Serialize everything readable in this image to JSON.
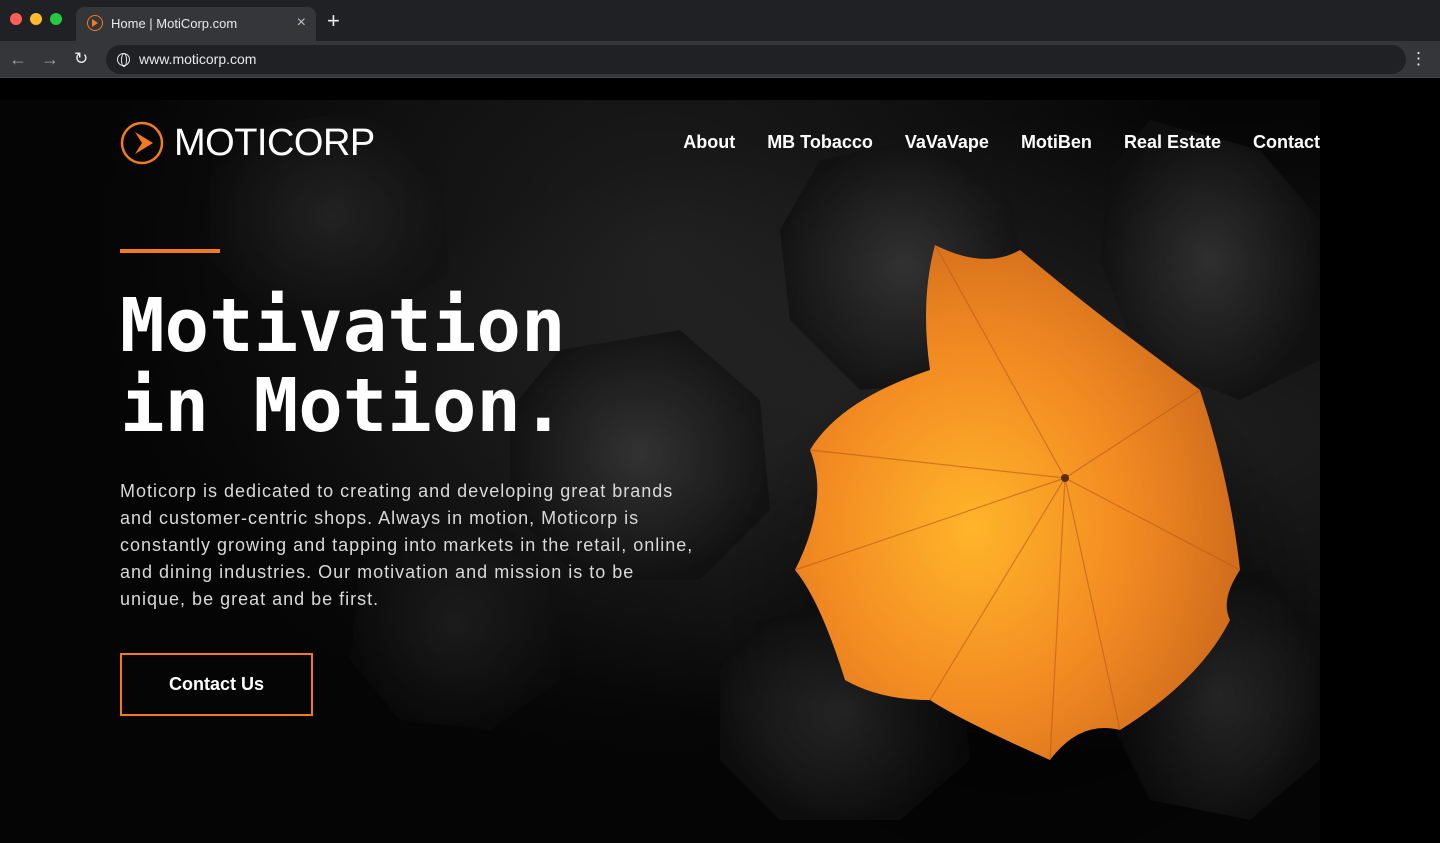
{
  "browser": {
    "tab_title": "Home | MotiCorp.com",
    "tab_close": "×",
    "new_tab": "+",
    "url": "www.moticorp.com",
    "back": "←",
    "forward": "→",
    "reload": "↻",
    "menu": "⋮"
  },
  "site": {
    "logo_text": "MOTICORP",
    "nav": [
      "About",
      "MB Tobacco",
      "VaVaVape",
      "MotiBen",
      "Real Estate",
      "Contact"
    ],
    "headline_line1": "Motivation",
    "headline_line2": "in Motion.",
    "description": "Moticorp is dedicated to creating and developing great brands and customer-centric shops. Always in motion, Moticorp is constantly growing and tapping into markets in the retail, online, and dining industries. Our motivation and mission is to be unique, be great and be first.",
    "cta_label": "Contact Us"
  },
  "colors": {
    "accent": "#f47a1f",
    "background": "#000000",
    "text": "#ffffff"
  }
}
